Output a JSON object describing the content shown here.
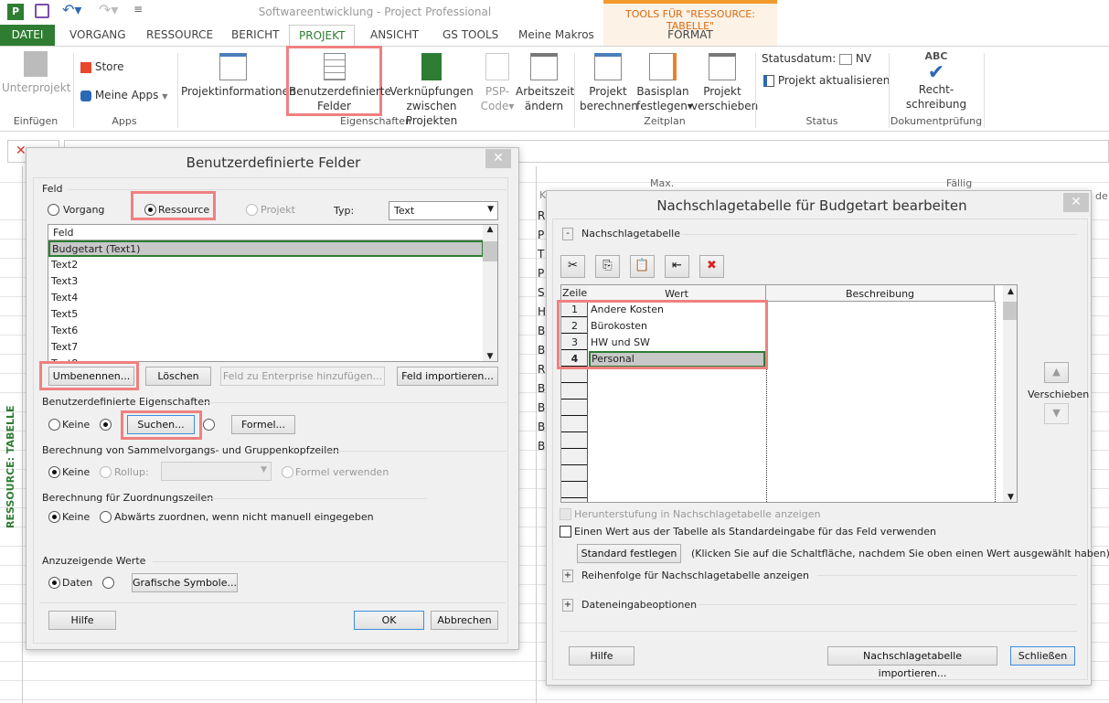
{
  "window": {
    "title": "Softwareentwicklung - Project Professional",
    "context_header": "TOOLS FÜR \"RESSOURCE: TABELLE\""
  },
  "tabs": [
    "DATEI",
    "VORGANG",
    "RESSOURCE",
    "BERICHT",
    "PROJEKT",
    "ANSICHT",
    "GS TOOLS",
    "Meine Makros",
    "FORMAT"
  ],
  "active_tab": "PROJEKT",
  "ribbon": {
    "unterprojekt": "Unterprojekt",
    "store": "Store",
    "meine_apps": "Meine Apps",
    "projektinformationen": "Projektinformationen",
    "benutzerdefinierte": "Benutzerdefinierte",
    "felder": "Felder",
    "verknuepfungen1": "Verknüpfungen",
    "verknuepfungen2": "zwischen Projekten",
    "psp1": "PSP-",
    "psp2": "Code",
    "arbeitszeit1": "Arbeitszeit",
    "arbeitszeit2": "ändern",
    "berechnen1": "Projekt",
    "berechnen2": "berechnen",
    "basisplan1": "Basisplan",
    "basisplan2": "festlegen",
    "verschieben1": "Projekt",
    "verschieben2": "verschieben",
    "statusdatum": "Statusdatum:",
    "statusdatum_value": "NV",
    "aktualisieren": "Projekt aktualisieren",
    "abc": "ABC",
    "recht1": "Recht-",
    "recht2": "schreibung",
    "groups": {
      "einfuegen": "Einfügen",
      "apps": "Apps",
      "eigenschaften": "Eigenschaften",
      "zeitplan": "Zeitplan",
      "status": "Status",
      "dokument": "Dokumentprüfung"
    }
  },
  "sheet": {
    "view_label": "RESSOURCE: TABELLE",
    "headers": {
      "k": "K",
      "max": "Max.",
      "faellig": "Fällig",
      "de": "de"
    },
    "initials": [
      "R",
      "P",
      "T",
      "P",
      "S",
      "H",
      "B",
      "B",
      "R",
      "B",
      "B",
      "B",
      "B"
    ]
  },
  "dialog1": {
    "title": "Benutzerdefinierte Felder",
    "feld": "Feld",
    "radio_vorgang": "Vorgang",
    "radio_ressource": "Ressource",
    "radio_projekt": "Projekt",
    "typ": "Typ:",
    "typ_value": "Text",
    "list_header": "Feld",
    "fields": [
      "Budgetart (Text1)",
      "Text2",
      "Text3",
      "Text4",
      "Text5",
      "Text6",
      "Text7",
      "Text8"
    ],
    "btn_umbenennen": "Umbenennen...",
    "btn_loeschen": "Löschen",
    "btn_enterprise": "Feld zu Enterprise hinzufügen...",
    "btn_importieren": "Feld importieren...",
    "eigenschaften": "Benutzerdefinierte Eigenschaften",
    "keine": "Keine",
    "btn_suchen": "Suchen...",
    "btn_formel": "Formel...",
    "sammel": "Berechnung von Sammelvorgangs- und Gruppenkopfzeilen",
    "rollup": "Rollup:",
    "formel_verwenden": "Formel verwenden",
    "zuordnung": "Berechnung für Zuordnungszeilen",
    "abwaerts": "Abwärts zuordnen, wenn nicht manuell eingegeben",
    "anzuzeigende": "Anzuzeigende Werte",
    "daten": "Daten",
    "btn_grafische": "Grafische Symbole...",
    "btn_hilfe": "Hilfe",
    "btn_ok": "OK",
    "btn_abbrechen": "Abbrechen"
  },
  "dialog2": {
    "title": "Nachschlagetabelle für Budgetart bearbeiten",
    "section": "Nachschlagetabelle",
    "toolbar": [
      "cut-icon",
      "copy-icon",
      "paste-icon",
      "insert-row-icon",
      "delete-row-icon"
    ],
    "headers": {
      "zeile": "Zeile",
      "wert": "Wert",
      "beschreibung": "Beschreibung"
    },
    "rows": [
      {
        "n": "1",
        "wert": "Andere Kosten"
      },
      {
        "n": "2",
        "wert": "Bürokosten"
      },
      {
        "n": "3",
        "wert": "HW und SW"
      },
      {
        "n": "4",
        "wert": "Personal"
      }
    ],
    "verschieben": "Verschieben",
    "chk_herunter": "Herunterstufung in Nachschlagetabelle anzeigen",
    "chk_standard": "Einen Wert aus der Tabelle als Standardeingabe für das Feld verwenden",
    "btn_standard": "Standard festlegen",
    "hint": "(Klicken Sie auf die Schaltfläche, nachdem Sie oben einen Wert ausgewählt haben)",
    "reihenfolge": "Reihenfolge für Nachschlagetabelle anzeigen",
    "dateneingabe": "Dateneingabeoptionen",
    "btn_hilfe": "Hilfe",
    "btn_import": "Nachschlagetabelle importieren...",
    "btn_schliessen": "Schließen"
  },
  "colors": {
    "accent": "#2e7d32",
    "highlight": "#f08080",
    "context": "#f39a2c"
  }
}
